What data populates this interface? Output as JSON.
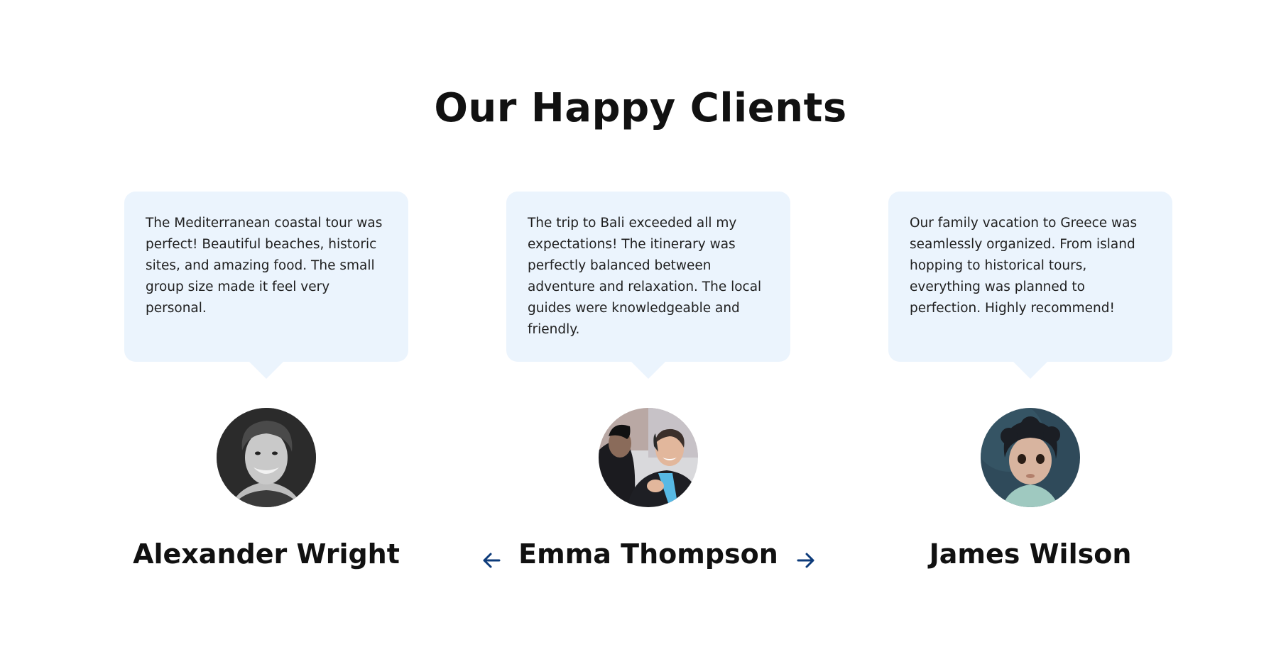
{
  "section": {
    "title": "Our Happy Clients"
  },
  "colors": {
    "bubble_background": "#ebf4fd",
    "arrow": "#0d3b7a",
    "heading": "#111111"
  },
  "testimonials": [
    {
      "quote": "The Mediterranean coastal tour was perfect! Beautiful beaches, historic sites, and amazing food. The small group size made it feel very personal.",
      "name": "Alexander Wright",
      "avatar": "smiling-young-man-black-and-white-photo"
    },
    {
      "quote": "The trip to Bali exceeded all my expectations! The itinerary was perfectly balanced between adventure and relaxation. The local guides were knowledgeable and friendly.",
      "name": "Emma Thompson",
      "avatar": "two-people-talking-outdoors-winter-photo"
    },
    {
      "quote": "Our family vacation to Greece was seamlessly organized. From island hopping to historical tours, everything was planned to perfection. Highly recommend!",
      "name": "James Wilson",
      "avatar": "curly-haired-child-portrait-photo"
    }
  ],
  "navigation": {
    "prev_icon": "arrow-left-icon",
    "next_icon": "arrow-right-icon"
  }
}
